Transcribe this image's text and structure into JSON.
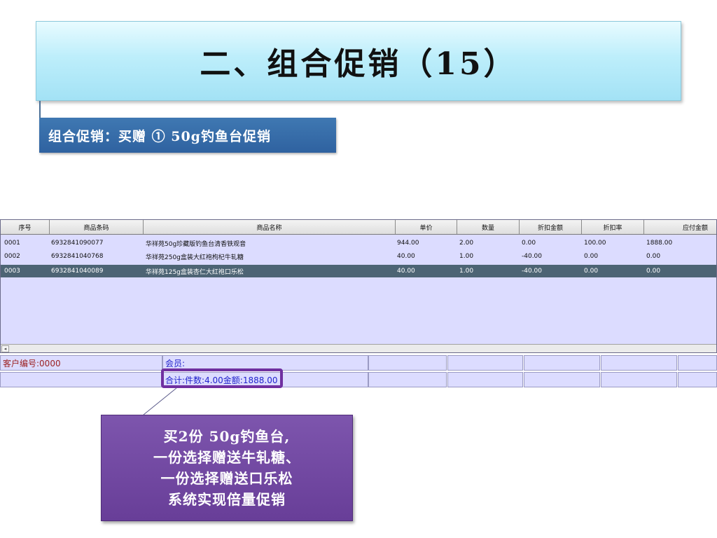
{
  "slide": {
    "title": "二、组合促销（15）",
    "subtitle": "组合促销：买赠 ① 50g钓鱼台促销"
  },
  "grid": {
    "columns": [
      "序号",
      "商品条码",
      "商品名称",
      "单价",
      "数量",
      "折扣金额",
      "折扣率",
      "应付金额"
    ],
    "rows": [
      [
        "0001",
        "6932841090077",
        "华祥苑50g珍藏版钓鱼台清香铁观音",
        "944.00",
        "2.00",
        "0.00",
        "100.00",
        "1888.00"
      ],
      [
        "0002",
        "6932841040768",
        "华祥苑250g盒装大红袍枸杞牛轧糖",
        "40.00",
        "1.00",
        "-40.00",
        "0.00",
        "0.00"
      ],
      [
        "0003",
        "6932841040089",
        "华祥苑125g盒装杏仁大红袍口乐松",
        "40.00",
        "1.00",
        "-40.00",
        "0.00",
        "0.00"
      ]
    ],
    "selected_row": 2,
    "scroll_left_glyph": "◂"
  },
  "info": {
    "customer_no": "客户编号:0000",
    "member": "会员:",
    "totals": "合计:件数:4.00金额:1888.00"
  },
  "callout": {
    "lines": [
      "买2份 50g钓鱼台,",
      "一份选择赠送牛轧糖、",
      "一份选择赠送口乐松",
      "系统实现倍量促销"
    ]
  },
  "colors": {
    "title_bg": "#bdeefb",
    "subtitle_bg": "#3a70ab",
    "grid_bg": "#dcdcff",
    "selected_row_bg": "#4d6474",
    "highlight_border": "#7030a0",
    "callout_bg": "#7651a6"
  }
}
